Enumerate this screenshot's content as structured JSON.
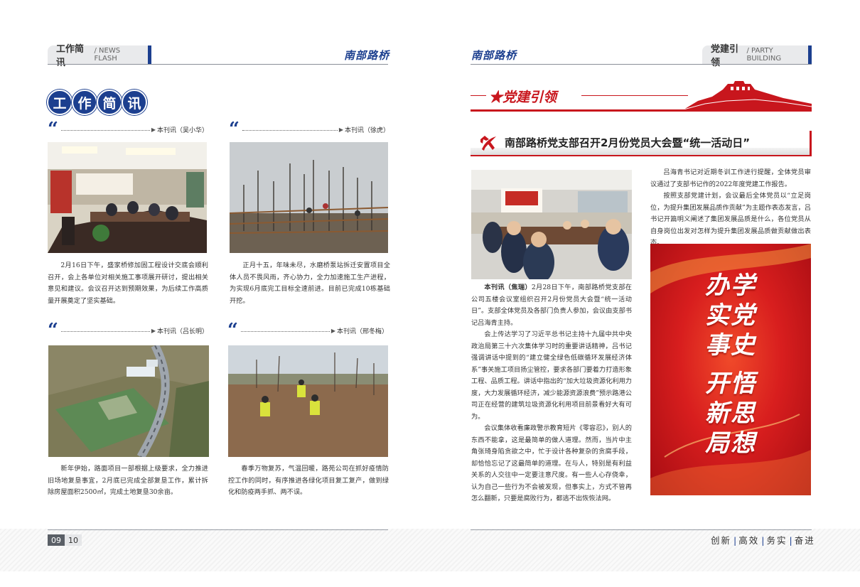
{
  "left_page": {
    "header_tab": "工作简讯",
    "header_tab_en": "NEWS FLASH",
    "brand": "南部路桥",
    "section_title": [
      "工",
      "作",
      "简",
      "讯"
    ],
    "articles": [
      {
        "byline": "本刊讯（吴小华）",
        "text": "2月16日下午，盛家桥修加固工程设计交底会顺利召开，会上各单位对相关施工事项展开研讨，提出相关意见和建议。会议召开达到预期效果，为后续工作高质量开展奠定了坚实基础。"
      },
      {
        "byline": "本刊讯（徐虎）",
        "text": "正月十五，年味未尽，水磨桥泵站拆迁安置项目全体人员不畏风雨，齐心协力，全力加速施工生产进程，为实现6月底完工目标全速前进。目前已完成10栋基础开挖。"
      },
      {
        "byline": "本刊讯（吕长明）",
        "text": "新年伊始，路面项目一部根据上级要求，全力推进旧场地复垦事宜，2月底已完成全部复垦工作，累计拆除房屋面积2500㎡，完成土地复垦30余亩。"
      },
      {
        "byline": "本刊讯（邢冬梅）",
        "text": "春季万物复苏，气温回暖，路苑公司在抓好疫情防控工作的同时，有序推进各绿化项目复工复产，做到绿化和防疫两手抓、两不误。"
      }
    ],
    "page_number": "09"
  },
  "right_page": {
    "brand": "南部路桥",
    "header_tab": "党建引领",
    "header_tab_en": "PARTY BUILDING",
    "section_title": "★党建引领",
    "headline": "南部路桥党支部召开2月份党员大会暨“统一活动日”",
    "paragraphs_col1": [
      {
        "lead": "本刊讯（焦瑞）",
        "text": "2月28日下午，南部路桥党支部在公司五楼会议室组织召开2月份党员大会暨“统一活动日”。支部全体党员及各部门负责人参加，会议由支部书记吕海青主持。"
      },
      {
        "lead": "",
        "text": "会上传达学习了习近平总书记主持十九届中共中央政治局第三十六次集体学习时的重要讲话精神，吕书记强调讲话中提到的“建立健全绿色低碳循环发展经济体系”事关施工项目扬尘管控，要求各部门要着力打造形象工程、品质工程。讲话中指出的“加大垃圾资源化利用力度，大力发展循环经济，减少能源资源浪费”预示路港公司正在经营的建筑垃圾资源化利用项目前景看好大有可为。"
      },
      {
        "lead": "",
        "text": "会议集体收看廉政警示教育短片《零容忍》，别人的东西不能拿，这是最简单的做人道理。然而，当片中主角张琦身陷贪欲之中，忙于设计各种复杂的贪腐手段，却恰恰忘记了这最简单的道理。在与人，特别是有利益关系的人交往中一定要注意尺度。有一些人心存侥幸，认为自己一些行为不会被发现，但事实上，方式不管再怎么翻新，只要是腐败行为，都逃不出恢恢法网。"
      }
    ],
    "paragraphs_col2": [
      "吕海青书记对近期冬训工作进行提醒，全体党员审议通过了支部书记作的2022年度党建工作报告。",
      "按照支部党建计划，会议最后全体党员以“立足岗位，为提升集团发展品质作贡献”为主题作表态发言，吕书记开篇明义阐述了集团发展品质是什么，各位党员从自身岗位出发对怎样为提升集团发展品质做贡献做出表态。"
    ],
    "poster": {
      "line1": "办学",
      "line2": "实党",
      "line3": "事史",
      "line4": "开悟",
      "line5": "新思",
      "line6": "局想"
    },
    "page_number": "10",
    "motto": [
      "创新",
      "高效",
      "务实",
      "奋进"
    ]
  },
  "colors": {
    "navy": "#1c3f8f",
    "party_red": "#c8161d"
  }
}
